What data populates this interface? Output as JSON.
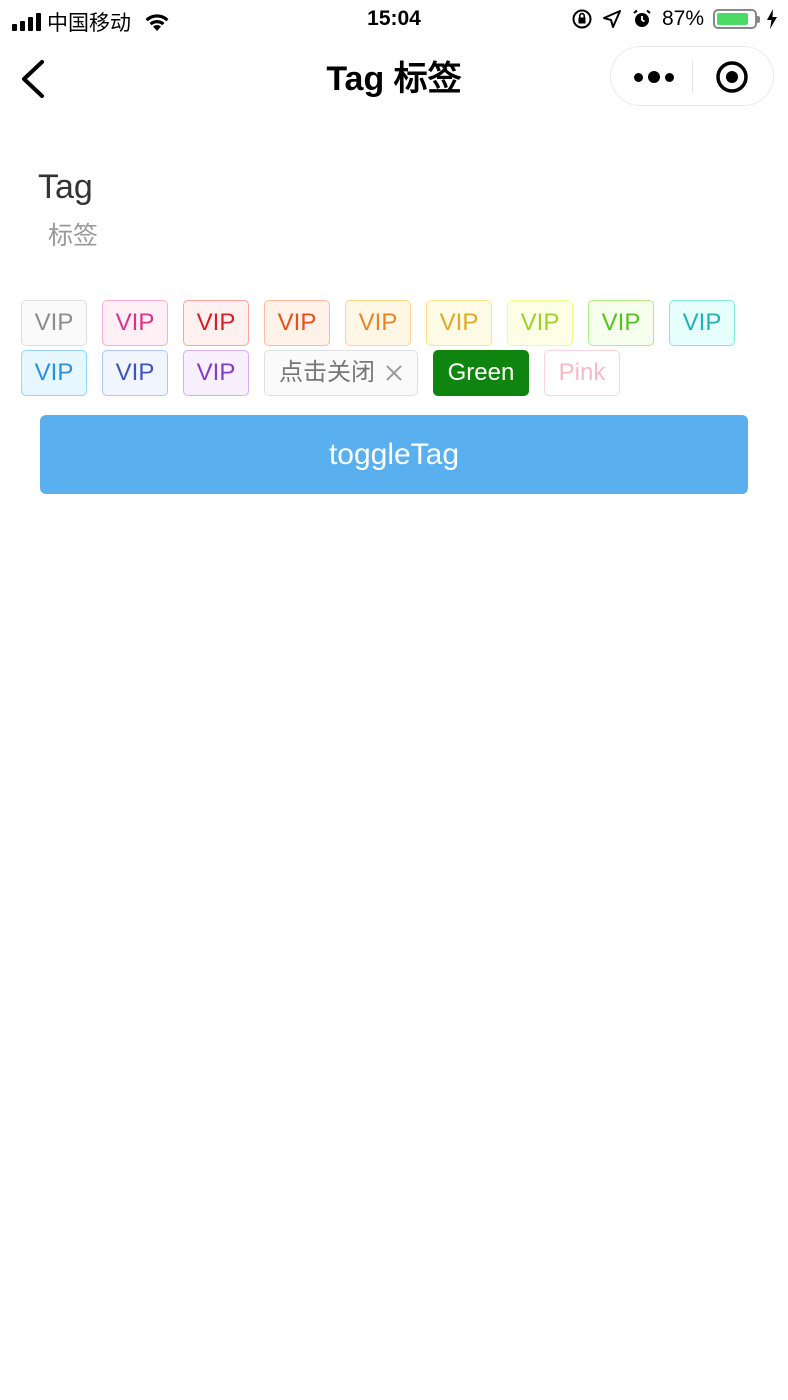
{
  "status_bar": {
    "carrier": "中国移动",
    "time": "15:04",
    "battery_percent": "87%",
    "battery_level": 0.87
  },
  "nav": {
    "title": "Tag 标签"
  },
  "header": {
    "title": "Tag",
    "desc": "标签"
  },
  "tag_rows": [
    [
      {
        "label": "VIP",
        "color": "#8c8c8c",
        "bg": "#fafafa",
        "border": "#e0e0e0"
      },
      {
        "label": "VIP",
        "color": "#d9338a",
        "bg": "#fff0f6",
        "border": "#ffadd2"
      },
      {
        "label": "VIP",
        "color": "#d32029",
        "bg": "#fff1f0",
        "border": "#ffa39e"
      },
      {
        "label": "VIP",
        "color": "#e8501a",
        "bg": "#fff2e8",
        "border": "#ffbb96"
      },
      {
        "label": "VIP",
        "color": "#e58525",
        "bg": "#fff7e6",
        "border": "#ffd591"
      },
      {
        "label": "VIP",
        "color": "#e0aa23",
        "bg": "#fffbe6",
        "border": "#ffe58f"
      },
      {
        "label": "VIP",
        "color": "#a0d12b",
        "bg": "#fcffe6",
        "border": "#eaff8f"
      },
      {
        "label": "VIP",
        "color": "#52c41a",
        "bg": "#f6ffed",
        "border": "#b7eb8f"
      },
      {
        "label": "VIP",
        "color": "#21b3b3",
        "bg": "#e6fffb",
        "border": "#87e8de"
      }
    ],
    [
      {
        "label": "VIP",
        "color": "#2b8fe0",
        "bg": "#e6f7ff",
        "border": "#91d5ff"
      },
      {
        "label": "VIP",
        "color": "#3d55c2",
        "bg": "#f0f5ff",
        "border": "#adc6ff"
      },
      {
        "label": "VIP",
        "color": "#7f3fbf",
        "bg": "#f9f0ff",
        "border": "#d3adf7"
      }
    ]
  ],
  "closable_tag": {
    "label": "点击关闭",
    "icon": "close-icon",
    "color": "#777777",
    "bg": "#fafafa",
    "border": "#e0e0e0"
  },
  "green_tag": {
    "label": "Green",
    "color": "#ffffff",
    "bg": "#0f850f"
  },
  "pink_tag": {
    "label": "Pink",
    "color": "#f7b9c9",
    "bg": "#ffffff",
    "border": "#f9d3dd"
  },
  "toggle_button": {
    "label": "toggleTag",
    "bg": "#5aafee"
  }
}
